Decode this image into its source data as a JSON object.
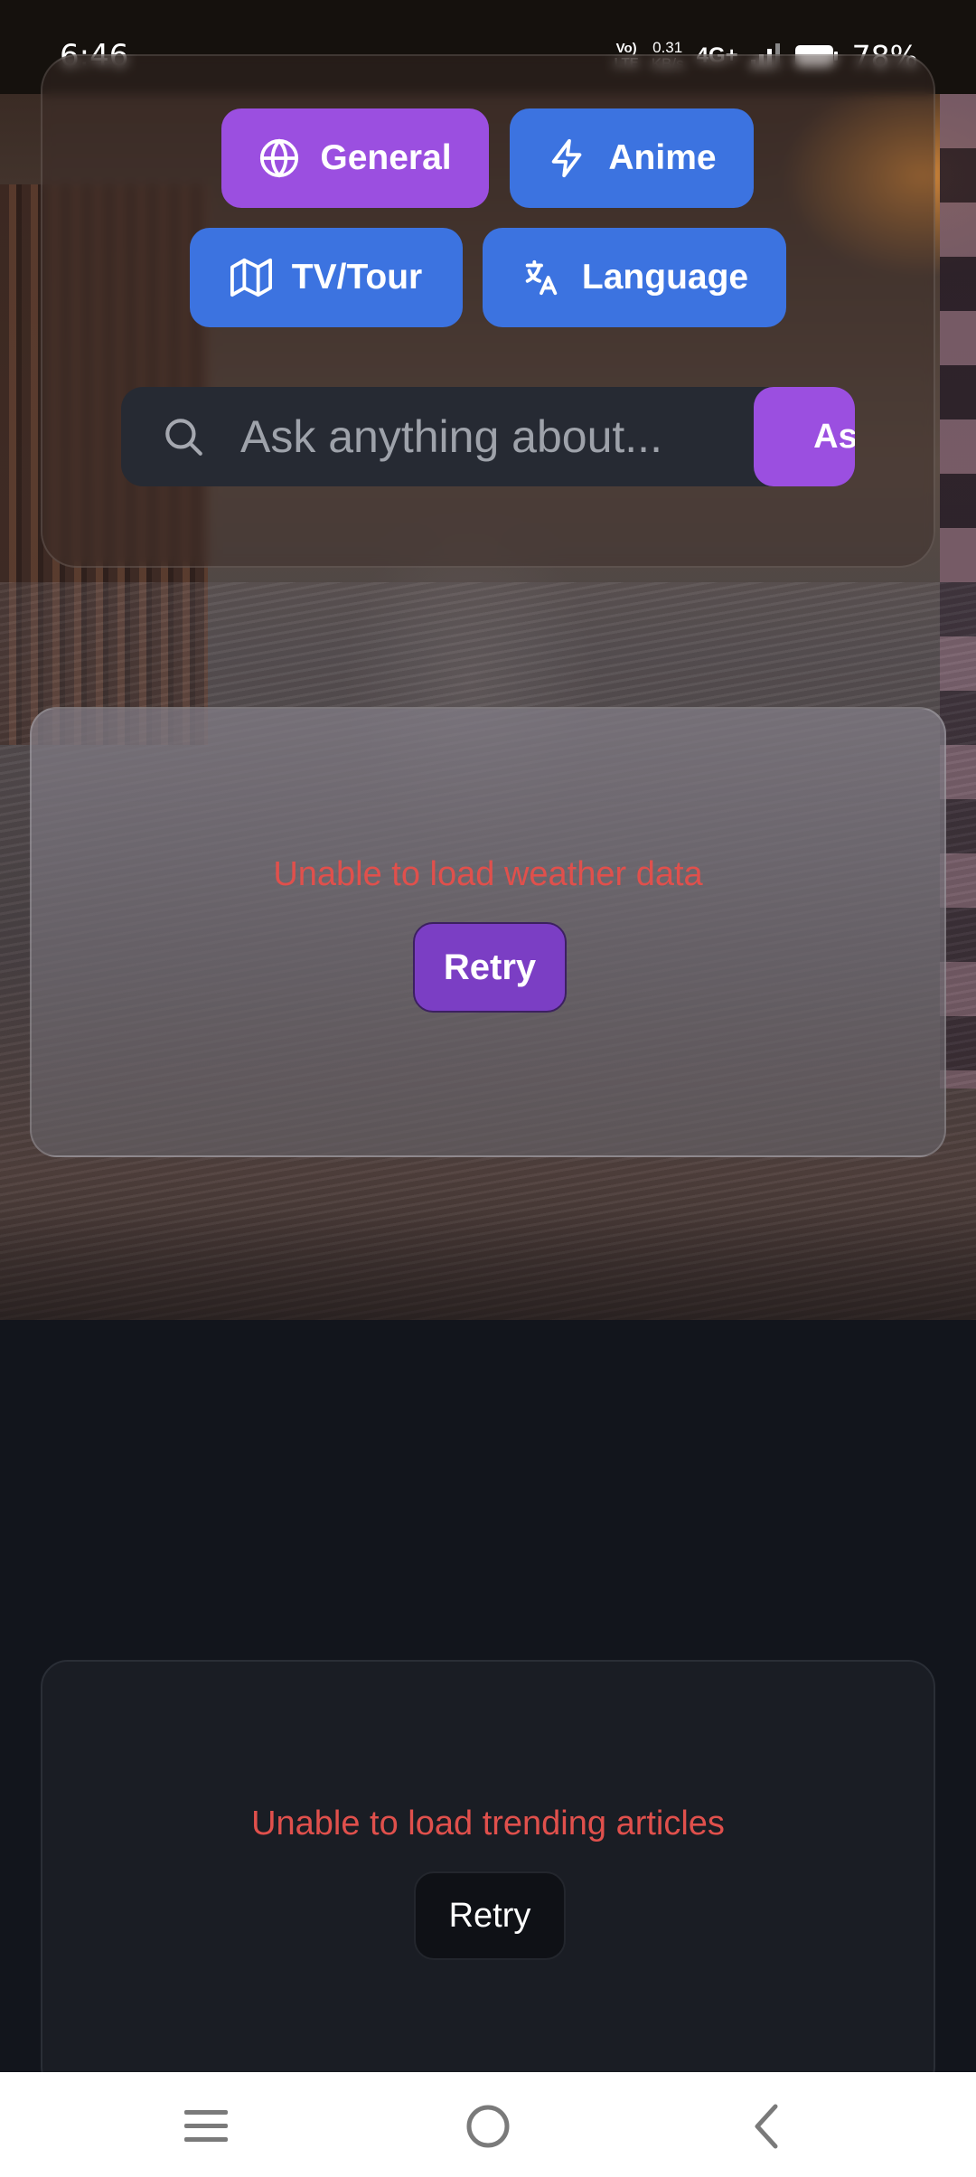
{
  "status_bar": {
    "time": "6:46",
    "volte": [
      "Vo)",
      "LTE"
    ],
    "speed": [
      "0.31",
      "KB/s"
    ],
    "network": "4G+",
    "battery": "78%"
  },
  "categories": {
    "general": "General",
    "anime": "Anime",
    "tv_tour": "TV/Tour",
    "language": "Language"
  },
  "search": {
    "placeholder": "Ask anything about...",
    "ask_label": "Ask"
  },
  "weather": {
    "error": "Unable to load weather data",
    "retry_label": "Retry"
  },
  "trending": {
    "error": "Unable to load trending articles",
    "retry_label": "Retry"
  },
  "colors": {
    "accent_purple": "#9b4fe0",
    "accent_blue": "#3c73e0",
    "error_red": "#e0504c"
  }
}
